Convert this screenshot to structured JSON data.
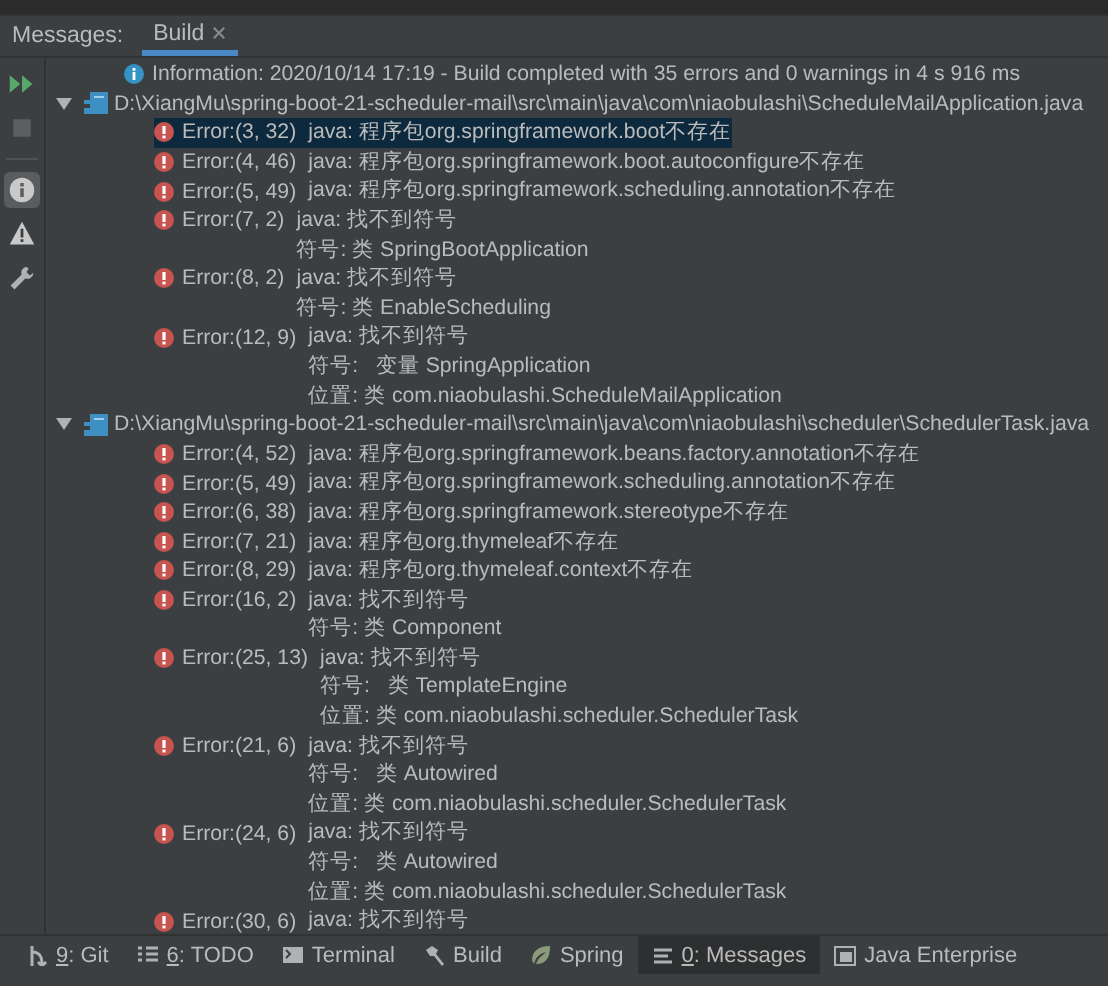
{
  "header": {
    "label": "Messages:",
    "tabs": [
      {
        "label": "Build",
        "selected": true,
        "closable": true
      }
    ]
  },
  "toolbar": [
    {
      "kind": "rerun",
      "selected": false
    },
    {
      "kind": "stop",
      "selected": false
    },
    {
      "kind": "info",
      "selected": true
    },
    {
      "kind": "warning",
      "selected": false
    },
    {
      "kind": "settings",
      "selected": false
    }
  ],
  "tree": [
    {
      "kind": "info",
      "text": "Information: 2020/10/14 17:19 - Build completed with 35 errors and 0 warnings in 4 s 916 ms"
    },
    {
      "kind": "file",
      "text": "D:\\XiangMu\\spring-boot-21-scheduler-mail\\src\\main\\java\\com\\niaobulashi\\ScheduleMailApplication.java",
      "expanded": true,
      "children": [
        {
          "kind": "error",
          "location": "Error:(3, 32)",
          "message": "java: 程序包org.springframework.boot不存在",
          "selected": true
        },
        {
          "kind": "error",
          "location": "Error:(4, 46)",
          "message": "java: 程序包org.springframework.boot.autoconfigure不存在",
          "selected": false
        },
        {
          "kind": "error",
          "location": "Error:(5, 49)",
          "message": "java: 程序包org.springframework.scheduling.annotation不存在",
          "selected": false
        },
        {
          "kind": "error",
          "location": "Error:(7, 2)",
          "message": "java: 找不到符号",
          "selected": false,
          "details": [
            "符号: 类 SpringBootApplication"
          ]
        },
        {
          "kind": "error",
          "location": "Error:(8, 2)",
          "message": "java: 找不到符号",
          "selected": false,
          "details": [
            "符号: 类 EnableScheduling"
          ]
        },
        {
          "kind": "error",
          "location": "Error:(12, 9)",
          "message": "java: 找不到符号",
          "selected": false,
          "details": [
            "符号:   变量 SpringApplication",
            "位置: 类 com.niaobulashi.ScheduleMailApplication"
          ]
        }
      ]
    },
    {
      "kind": "file",
      "text": "D:\\XiangMu\\spring-boot-21-scheduler-mail\\src\\main\\java\\com\\niaobulashi\\scheduler\\SchedulerTask.java",
      "expanded": true,
      "children": [
        {
          "kind": "error",
          "location": "Error:(4, 52)",
          "message": "java: 程序包org.springframework.beans.factory.annotation不存在",
          "selected": false
        },
        {
          "kind": "error",
          "location": "Error:(5, 49)",
          "message": "java: 程序包org.springframework.scheduling.annotation不存在",
          "selected": false
        },
        {
          "kind": "error",
          "location": "Error:(6, 38)",
          "message": "java: 程序包org.springframework.stereotype不存在",
          "selected": false
        },
        {
          "kind": "error",
          "location": "Error:(7, 21)",
          "message": "java: 程序包org.thymeleaf不存在",
          "selected": false
        },
        {
          "kind": "error",
          "location": "Error:(8, 29)",
          "message": "java: 程序包org.thymeleaf.context不存在",
          "selected": false
        },
        {
          "kind": "error",
          "location": "Error:(16, 2)",
          "message": "java: 找不到符号",
          "selected": false,
          "details": [
            "符号: 类 Component"
          ]
        },
        {
          "kind": "error",
          "location": "Error:(25, 13)",
          "message": "java: 找不到符号",
          "selected": false,
          "details": [
            "符号:   类 TemplateEngine",
            "位置: 类 com.niaobulashi.scheduler.SchedulerTask"
          ]
        },
        {
          "kind": "error",
          "location": "Error:(21, 6)",
          "message": "java: 找不到符号",
          "selected": false,
          "details": [
            "符号:   类 Autowired",
            "位置: 类 com.niaobulashi.scheduler.SchedulerTask"
          ]
        },
        {
          "kind": "error",
          "location": "Error:(24, 6)",
          "message": "java: 找不到符号",
          "selected": false,
          "details": [
            "符号:   类 Autowired",
            "位置: 类 com.niaobulashi.scheduler.SchedulerTask"
          ]
        },
        {
          "kind": "error",
          "location": "Error:(30, 6)",
          "message": "java: 找不到符号",
          "selected": false
        }
      ]
    }
  ],
  "tool_windows": [
    {
      "kind": "git",
      "label": "9: Git",
      "mnemonic": true,
      "selected": false
    },
    {
      "kind": "todo",
      "label": "6: TODO",
      "mnemonic": true,
      "selected": false
    },
    {
      "kind": "terminal",
      "label": "Terminal",
      "mnemonic": false,
      "selected": false
    },
    {
      "kind": "build",
      "label": "Build",
      "mnemonic": false,
      "selected": false
    },
    {
      "kind": "spring",
      "label": "Spring",
      "mnemonic": false,
      "selected": false
    },
    {
      "kind": "messages",
      "label": "0: Messages",
      "mnemonic": true,
      "selected": true
    },
    {
      "kind": "javaee",
      "label": "Java Enterprise",
      "mnemonic": false,
      "selected": false
    }
  ]
}
